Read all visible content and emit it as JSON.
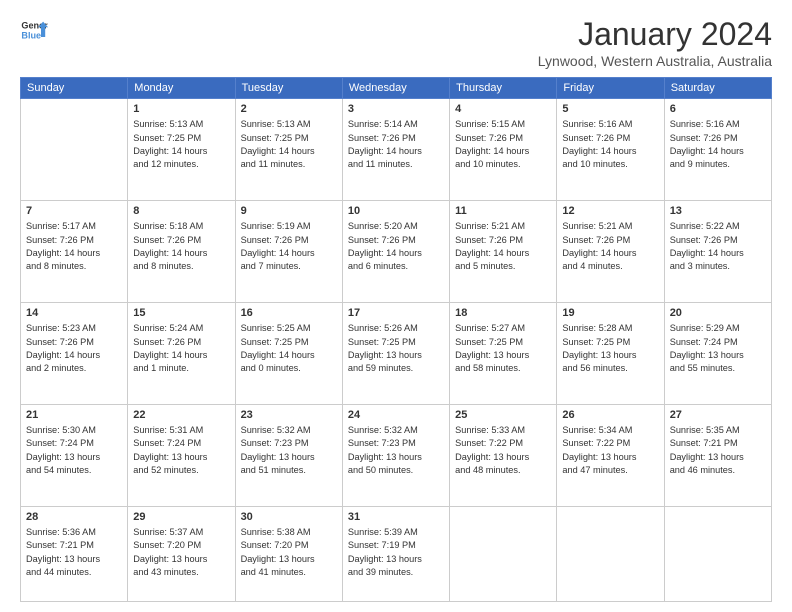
{
  "header": {
    "logo_line1": "General",
    "logo_line2": "Blue",
    "month": "January 2024",
    "location": "Lynwood, Western Australia, Australia"
  },
  "days_of_week": [
    "Sunday",
    "Monday",
    "Tuesday",
    "Wednesday",
    "Thursday",
    "Friday",
    "Saturday"
  ],
  "weeks": [
    [
      {
        "day": "",
        "info": ""
      },
      {
        "day": "1",
        "info": "Sunrise: 5:13 AM\nSunset: 7:25 PM\nDaylight: 14 hours\nand 12 minutes."
      },
      {
        "day": "2",
        "info": "Sunrise: 5:13 AM\nSunset: 7:25 PM\nDaylight: 14 hours\nand 11 minutes."
      },
      {
        "day": "3",
        "info": "Sunrise: 5:14 AM\nSunset: 7:26 PM\nDaylight: 14 hours\nand 11 minutes."
      },
      {
        "day": "4",
        "info": "Sunrise: 5:15 AM\nSunset: 7:26 PM\nDaylight: 14 hours\nand 10 minutes."
      },
      {
        "day": "5",
        "info": "Sunrise: 5:16 AM\nSunset: 7:26 PM\nDaylight: 14 hours\nand 10 minutes."
      },
      {
        "day": "6",
        "info": "Sunrise: 5:16 AM\nSunset: 7:26 PM\nDaylight: 14 hours\nand 9 minutes."
      }
    ],
    [
      {
        "day": "7",
        "info": "Sunrise: 5:17 AM\nSunset: 7:26 PM\nDaylight: 14 hours\nand 8 minutes."
      },
      {
        "day": "8",
        "info": "Sunrise: 5:18 AM\nSunset: 7:26 PM\nDaylight: 14 hours\nand 8 minutes."
      },
      {
        "day": "9",
        "info": "Sunrise: 5:19 AM\nSunset: 7:26 PM\nDaylight: 14 hours\nand 7 minutes."
      },
      {
        "day": "10",
        "info": "Sunrise: 5:20 AM\nSunset: 7:26 PM\nDaylight: 14 hours\nand 6 minutes."
      },
      {
        "day": "11",
        "info": "Sunrise: 5:21 AM\nSunset: 7:26 PM\nDaylight: 14 hours\nand 5 minutes."
      },
      {
        "day": "12",
        "info": "Sunrise: 5:21 AM\nSunset: 7:26 PM\nDaylight: 14 hours\nand 4 minutes."
      },
      {
        "day": "13",
        "info": "Sunrise: 5:22 AM\nSunset: 7:26 PM\nDaylight: 14 hours\nand 3 minutes."
      }
    ],
    [
      {
        "day": "14",
        "info": "Sunrise: 5:23 AM\nSunset: 7:26 PM\nDaylight: 14 hours\nand 2 minutes."
      },
      {
        "day": "15",
        "info": "Sunrise: 5:24 AM\nSunset: 7:26 PM\nDaylight: 14 hours\nand 1 minute."
      },
      {
        "day": "16",
        "info": "Sunrise: 5:25 AM\nSunset: 7:25 PM\nDaylight: 14 hours\nand 0 minutes."
      },
      {
        "day": "17",
        "info": "Sunrise: 5:26 AM\nSunset: 7:25 PM\nDaylight: 13 hours\nand 59 minutes."
      },
      {
        "day": "18",
        "info": "Sunrise: 5:27 AM\nSunset: 7:25 PM\nDaylight: 13 hours\nand 58 minutes."
      },
      {
        "day": "19",
        "info": "Sunrise: 5:28 AM\nSunset: 7:25 PM\nDaylight: 13 hours\nand 56 minutes."
      },
      {
        "day": "20",
        "info": "Sunrise: 5:29 AM\nSunset: 7:24 PM\nDaylight: 13 hours\nand 55 minutes."
      }
    ],
    [
      {
        "day": "21",
        "info": "Sunrise: 5:30 AM\nSunset: 7:24 PM\nDaylight: 13 hours\nand 54 minutes."
      },
      {
        "day": "22",
        "info": "Sunrise: 5:31 AM\nSunset: 7:24 PM\nDaylight: 13 hours\nand 52 minutes."
      },
      {
        "day": "23",
        "info": "Sunrise: 5:32 AM\nSunset: 7:23 PM\nDaylight: 13 hours\nand 51 minutes."
      },
      {
        "day": "24",
        "info": "Sunrise: 5:32 AM\nSunset: 7:23 PM\nDaylight: 13 hours\nand 50 minutes."
      },
      {
        "day": "25",
        "info": "Sunrise: 5:33 AM\nSunset: 7:22 PM\nDaylight: 13 hours\nand 48 minutes."
      },
      {
        "day": "26",
        "info": "Sunrise: 5:34 AM\nSunset: 7:22 PM\nDaylight: 13 hours\nand 47 minutes."
      },
      {
        "day": "27",
        "info": "Sunrise: 5:35 AM\nSunset: 7:21 PM\nDaylight: 13 hours\nand 46 minutes."
      }
    ],
    [
      {
        "day": "28",
        "info": "Sunrise: 5:36 AM\nSunset: 7:21 PM\nDaylight: 13 hours\nand 44 minutes."
      },
      {
        "day": "29",
        "info": "Sunrise: 5:37 AM\nSunset: 7:20 PM\nDaylight: 13 hours\nand 43 minutes."
      },
      {
        "day": "30",
        "info": "Sunrise: 5:38 AM\nSunset: 7:20 PM\nDaylight: 13 hours\nand 41 minutes."
      },
      {
        "day": "31",
        "info": "Sunrise: 5:39 AM\nSunset: 7:19 PM\nDaylight: 13 hours\nand 39 minutes."
      },
      {
        "day": "",
        "info": ""
      },
      {
        "day": "",
        "info": ""
      },
      {
        "day": "",
        "info": ""
      }
    ]
  ]
}
